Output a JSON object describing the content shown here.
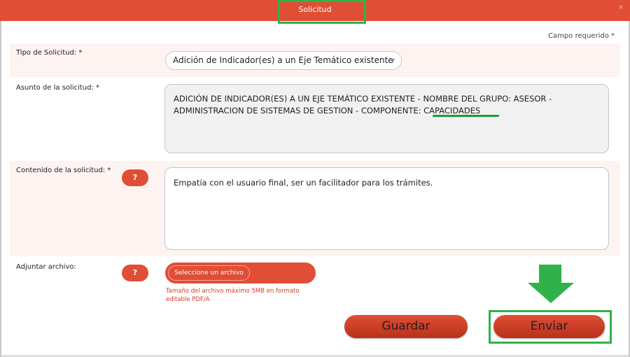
{
  "window": {
    "title": "Solicitud",
    "close_glyph": "×"
  },
  "form": {
    "required_note": "Campo requerido *",
    "tipo": {
      "label": "Tipo de Solicitud: *",
      "value": "Adición de Indicador(es) a un Eje Temático existente",
      "arrow_icon": "chevron-down-icon"
    },
    "asunto": {
      "label": "Asunto de la solicitud: *",
      "line1": "ADICIÓN DE INDICADOR(ES) A UN EJE TEMÁTICO EXISTENTE - NOMBRE DEL GRUPO: ASESOR -",
      "line2": "ADMINISTRACION DE SISTEMAS DE GESTION - COMPONENTE: CAPACIDADES"
    },
    "contenido": {
      "label": "Contenido de la solicitud: *",
      "value": "Empatía con el usuario final, ser un facilitador para los trámites.",
      "help_label": "?"
    },
    "adjuntar": {
      "label": "Adjuntar archivo:",
      "help_label": "?",
      "button_label": "Seleccione un archivo",
      "note": "Tamaño del archivo máximo 5MB en formato editable PDF/A"
    }
  },
  "actions": {
    "save_label": "Guardar",
    "send_label": "Enviar"
  },
  "colors": {
    "brand": "#e04e36",
    "annotation": "#2fb24a"
  }
}
